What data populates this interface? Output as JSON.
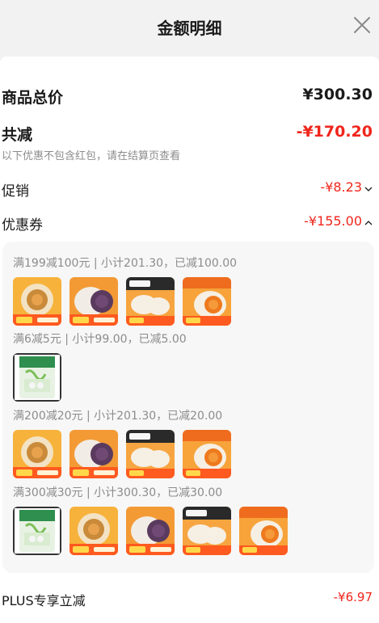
{
  "header": {
    "title": "金额明细"
  },
  "summary": {
    "total_label": "商品总价",
    "total_value": "¥300.30",
    "reduce_label": "共减",
    "reduce_value": "-¥170.20",
    "reduce_note": "以下优惠不包含红包，请在结算页查看"
  },
  "promo": {
    "label": "促销",
    "value": "-¥8.23"
  },
  "coupon": {
    "label": "优惠券",
    "value": "-¥155.00",
    "groups": [
      {
        "title": "满199减100元 | 小计201.30，已减100.00",
        "items": [
          "salted-duck-egg-yolk-bun",
          "purple-taro-bun",
          "pork-bun",
          "salted-egg-bun"
        ]
      },
      {
        "title": "满6减5元 | 小计99.00，已减5.00",
        "items": [
          "rice-bag"
        ]
      },
      {
        "title": "满200减20元 | 小计201.30，已减20.00",
        "items": [
          "salted-duck-egg-yolk-bun",
          "purple-taro-bun",
          "pork-bun",
          "salted-egg-bun"
        ]
      },
      {
        "title": "满300减30元 | 小计300.30，已减30.00",
        "items": [
          "rice-bag",
          "salted-duck-egg-yolk-bun",
          "purple-taro-bun",
          "pork-bun",
          "salted-egg-bun"
        ]
      }
    ]
  },
  "plus": {
    "label": "PLUS专享立减",
    "value": "-¥6.97"
  },
  "colors": {
    "accent_red": "#f0251b",
    "muted_text": "#8c8c8c",
    "panel_bg": "#f7f7f7"
  }
}
